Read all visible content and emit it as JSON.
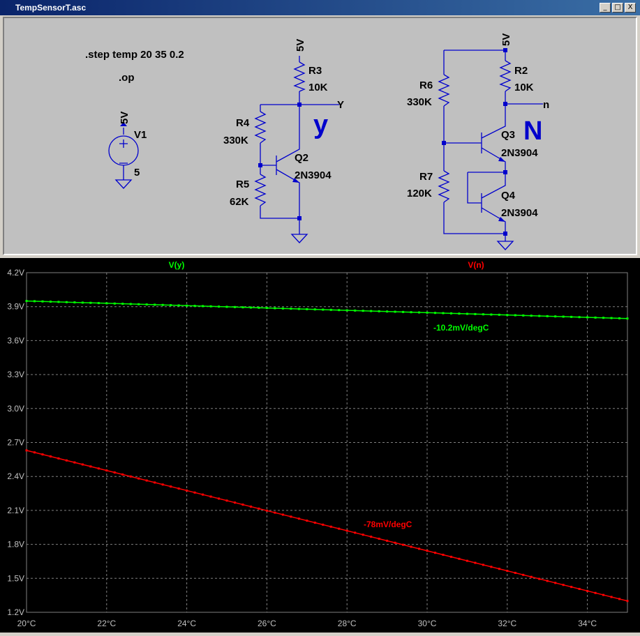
{
  "window": {
    "title": "TempSensorT.asc",
    "buttons": [
      "_",
      "□",
      "X"
    ]
  },
  "schematic": {
    "directives": [
      ".step temp 20 35 0.2",
      ".op"
    ],
    "source": {
      "name": "V1",
      "value": "5",
      "rail": "5V"
    },
    "circuit_y": {
      "rail": "5V",
      "label": "y",
      "output_label": "Y",
      "R3": {
        "name": "R3",
        "value": "10K"
      },
      "R4": {
        "name": "R4",
        "value": "330K"
      },
      "R5": {
        "name": "R5",
        "value": "62K"
      },
      "Q2": {
        "name": "Q2",
        "model": "2N3904"
      }
    },
    "circuit_n": {
      "rail": "5V",
      "label": "N",
      "output_label": "n",
      "R2": {
        "name": "R2",
        "value": "10K"
      },
      "R6": {
        "name": "R6",
        "value": "330K"
      },
      "R7": {
        "name": "R7",
        "value": "120K"
      },
      "Q3": {
        "name": "Q3",
        "model": "2N3904"
      },
      "Q4": {
        "name": "Q4",
        "model": "2N3904"
      }
    },
    "colors": {
      "wire": "#0000cc",
      "text": "#000000",
      "big_label": "#0000cc"
    }
  },
  "chart_data": {
    "type": "line",
    "x_unit": "°C",
    "xlim": [
      20,
      35
    ],
    "ylim": [
      1.2,
      4.2
    ],
    "x_ticks": [
      "20°C",
      "22°C",
      "24°C",
      "26°C",
      "28°C",
      "30°C",
      "32°C",
      "34°C"
    ],
    "y_ticks": [
      "4.2V",
      "3.9V",
      "3.6V",
      "3.3V",
      "3.0V",
      "2.7V",
      "2.4V",
      "2.1V",
      "1.8V",
      "1.5V",
      "1.2V"
    ],
    "grid": true,
    "series": [
      {
        "name": "V(y)",
        "color": "#00ff00",
        "x": [
          20,
          35
        ],
        "values": [
          3.95,
          3.795
        ],
        "annotation": "-10.2mV/degC"
      },
      {
        "name": "V(n)",
        "color": "#ff0000",
        "x": [
          20,
          35
        ],
        "values": [
          2.63,
          1.3
        ],
        "annotation": "-78mV/degC"
      }
    ]
  }
}
